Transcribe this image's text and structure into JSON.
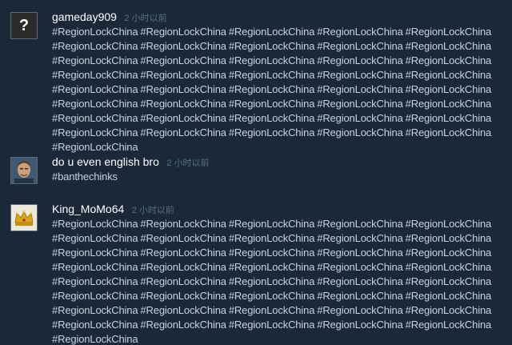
{
  "comments": [
    {
      "author": "gameday909",
      "time": "2 小时以前",
      "avatar_icon": "question-mark-icon",
      "avatar_glyph": "?",
      "text": "#RegionLockChina #RegionLockChina #RegionLockChina #RegionLockChina #RegionLockChina #RegionLockChina #RegionLockChina #RegionLockChina #RegionLockChina #RegionLockChina #RegionLockChina #RegionLockChina #RegionLockChina #RegionLockChina #RegionLockChina #RegionLockChina #RegionLockChina #RegionLockChina #RegionLockChina #RegionLockChina #RegionLockChina #RegionLockChina #RegionLockChina #RegionLockChina #RegionLockChina #RegionLockChina #RegionLockChina #RegionLockChina #RegionLockChina #RegionLockChina #RegionLockChina #RegionLockChina #RegionLockChina #RegionLockChina #RegionLockChina #RegionLockChina #RegionLockChina #RegionLockChina #RegionLockChina #RegionLockChina #RegionLockChina"
    },
    {
      "author": "do u even english bro",
      "time": "2 小时以前",
      "avatar_icon": "user-photo-avatar",
      "text": "#banthechinks"
    },
    {
      "author": "King_MoMo64",
      "time": "2 小时以前",
      "avatar_icon": "crown-icon",
      "text": "#RegionLockChina #RegionLockChina #RegionLockChina #RegionLockChina #RegionLockChina #RegionLockChina #RegionLockChina #RegionLockChina #RegionLockChina #RegionLockChina #RegionLockChina #RegionLockChina #RegionLockChina #RegionLockChina #RegionLockChina #RegionLockChina #RegionLockChina #RegionLockChina #RegionLockChina #RegionLockChina #RegionLockChina #RegionLockChina #RegionLockChina #RegionLockChina #RegionLockChina #RegionLockChina #RegionLockChina #RegionLockChina #RegionLockChina #RegionLockChina #RegionLockChina #RegionLockChina #RegionLockChina #RegionLockChina #RegionLockChina #RegionLockChina #RegionLockChina #RegionLockChina #RegionLockChina #RegionLockChina #RegionLockChina"
    }
  ],
  "colors": {
    "background": "#1b2838",
    "author": "#ffffff",
    "timestamp": "#56707f",
    "text": "#c6d4df"
  }
}
